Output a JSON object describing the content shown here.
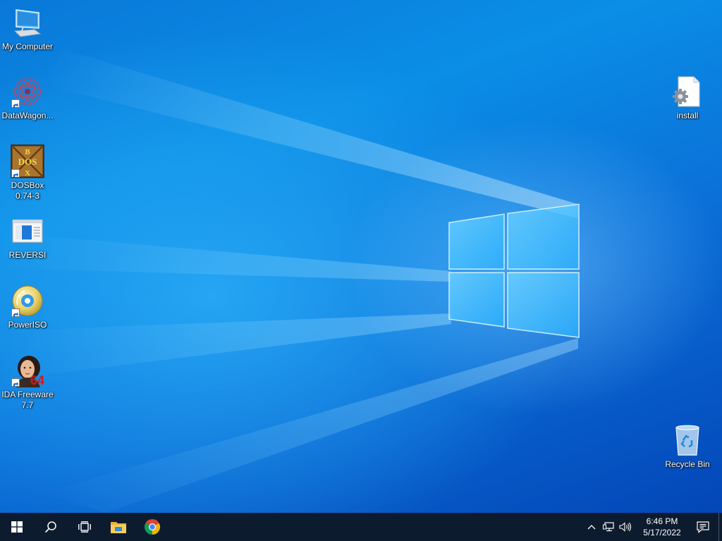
{
  "desktop": {
    "icons": [
      {
        "name": "my-computer",
        "label": "My Computer",
        "icon": "computer-icon",
        "shortcut": false
      },
      {
        "name": "datawagon",
        "label": "DataWagon...",
        "icon": "datawagon-icon",
        "shortcut": true
      },
      {
        "name": "dosbox",
        "label": "DOSBox\n0.74-3",
        "icon": "dosbox-icon",
        "shortcut": true
      },
      {
        "name": "reversi",
        "label": "REVERSI",
        "icon": "window-app-icon",
        "shortcut": false
      },
      {
        "name": "poweriso",
        "label": "PowerISO",
        "icon": "disc-icon",
        "shortcut": true
      },
      {
        "name": "ida-freeware",
        "label": "IDA Freeware\n7.7",
        "icon": "ida-portrait-icon",
        "shortcut": true
      },
      {
        "name": "install",
        "label": "install",
        "icon": "settings-file-icon",
        "shortcut": false
      },
      {
        "name": "recycle-bin",
        "label": "Recycle Bin",
        "icon": "recycle-bin-icon",
        "shortcut": false
      }
    ],
    "dosbox_letters": {
      "top": "B",
      "middle": "DOS",
      "bottom": "X"
    },
    "ida_badge": "64"
  },
  "taskbar": {
    "buttons": [
      {
        "name": "start",
        "icon": "windows-logo-icon"
      },
      {
        "name": "search",
        "icon": "search-icon"
      },
      {
        "name": "task-view",
        "icon": "task-view-icon"
      },
      {
        "name": "file-explorer",
        "icon": "folder-icon"
      },
      {
        "name": "chrome",
        "icon": "chrome-icon"
      }
    ],
    "tray": {
      "chevron": "chevron-up-icon",
      "network": "network-icon",
      "volume": "speaker-icon",
      "time": "6:46 PM",
      "date": "5/17/2022",
      "notifications": "action-center-icon"
    }
  },
  "colors": {
    "taskbar": "#0d1b2e",
    "wallpaper_accent": "#0a8ee6",
    "chrome_red": "#db4437",
    "chrome_green": "#0f9d58",
    "chrome_yellow": "#f4b400",
    "chrome_blue": "#4285f4"
  }
}
